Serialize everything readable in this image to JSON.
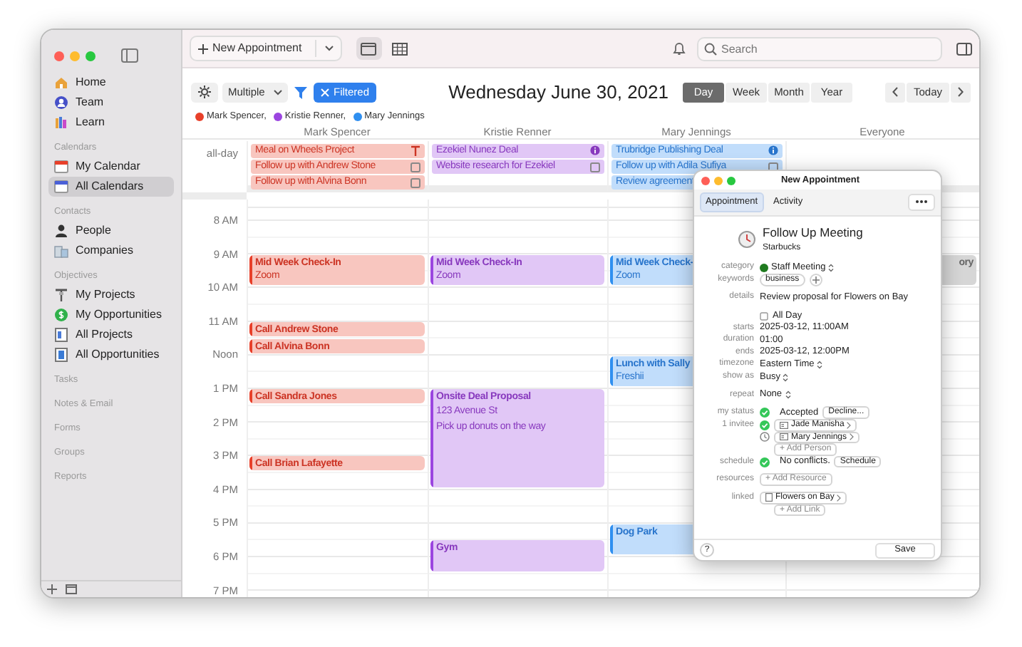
{
  "sidebar": {
    "sections": [
      {
        "items": [
          {
            "label": "Home",
            "kind": "home",
            "selected": false
          },
          {
            "label": "Team",
            "kind": "team",
            "selected": false
          },
          {
            "label": "Learn",
            "kind": "learn",
            "selected": false
          }
        ]
      },
      {
        "heading": "Calendars",
        "items": [
          {
            "label": "My Calendar",
            "kind": "calendar",
            "selected": false
          },
          {
            "label": "All Calendars",
            "kind": "calendars",
            "selected": true
          }
        ]
      },
      {
        "heading": "Contacts",
        "items": [
          {
            "label": "People",
            "kind": "person",
            "selected": false
          },
          {
            "label": "Companies",
            "kind": "companies",
            "selected": false
          }
        ]
      },
      {
        "heading": "Objectives",
        "items": [
          {
            "label": "My Projects",
            "kind": "projects",
            "selected": false
          },
          {
            "label": "My Opportunities",
            "kind": "opportunity",
            "selected": false
          },
          {
            "label": "All Projects",
            "kind": "project-list",
            "selected": false
          },
          {
            "label": "All Opportunities",
            "kind": "opportunity-list",
            "selected": false
          }
        ]
      },
      {
        "heading": "Tasks"
      },
      {
        "heading": "Notes & Email"
      },
      {
        "heading": "Forms"
      },
      {
        "heading": "Groups"
      },
      {
        "heading": "Reports"
      }
    ]
  },
  "toolbar": {
    "new_button": "New Appointment",
    "views": [
      {
        "kind": "day",
        "selected": true
      },
      {
        "kind": "grid",
        "selected": false
      }
    ],
    "search": {
      "placeholder": "Search"
    }
  },
  "filter_bar": {
    "mode": "Multiple",
    "filter": "Filtered",
    "date": "Wednesday June 30, 2021",
    "ranges": [
      {
        "label": "Day",
        "selected": true
      },
      {
        "label": "Week",
        "selected": false
      },
      {
        "label": "Month",
        "selected": false
      },
      {
        "label": "Year",
        "selected": false
      }
    ],
    "today": "Today",
    "people": [
      {
        "name": "Mark Spencer,",
        "color": "#e8402a"
      },
      {
        "name": "Kristie Renner,",
        "color": "#9b45e0"
      },
      {
        "name": "Mary Jennings",
        "color": "#2f8ff0"
      }
    ]
  },
  "calendar": {
    "all_day_label": "all-day",
    "hour_labels": [
      "8 AM",
      "9 AM",
      "10 AM",
      "11 AM",
      "Noon",
      "1 PM",
      "2 PM",
      "3 PM",
      "4 PM",
      "5 PM",
      "6 PM",
      "7 PM"
    ],
    "columns": [
      {
        "name": "Mark Spencer",
        "color": "#e8402a",
        "all_day": [
          {
            "title": "Meal on Wheels Project",
            "kind": "project"
          },
          {
            "title": "Follow up with Andrew Stone",
            "kind": "task",
            "checked": false
          },
          {
            "title": "Follow up with Alvina Bonn",
            "kind": "task",
            "checked": false
          }
        ],
        "events": [
          {
            "lines": [
              "Mid Week Check-In",
              "Zoom"
            ]
          },
          {
            "lines": [
              "Call Andrew Stone"
            ]
          },
          {
            "lines": [
              "Call Alvina Bonn"
            ]
          },
          {
            "lines": [
              "Call Sandra Jones"
            ]
          },
          {
            "lines": [
              "Call Brian Lafayette"
            ]
          }
        ]
      },
      {
        "name": "Kristie Renner",
        "color": "#9b45e0",
        "all_day": [
          {
            "title": "Ezekiel Nunez Deal",
            "kind": "deal"
          },
          {
            "title": "Website research for Ezekiel",
            "kind": "task",
            "checked": false
          }
        ],
        "events": [
          {
            "lines": [
              "Mid Week Check-In",
              "Zoom"
            ]
          },
          {
            "lines": [
              "Onsite Deal Proposal",
              "123 Avenue St",
              "Pick up donuts on the way"
            ]
          },
          {
            "lines": [
              "Gym"
            ]
          }
        ]
      },
      {
        "name": "Mary Jennings",
        "color": "#2f8ff0",
        "all_day": [
          {
            "title": "Trubridge Publishing Deal",
            "kind": "deal"
          },
          {
            "title": "Follow up with Adila Sufiya",
            "kind": "task",
            "checked": false
          },
          {
            "title": "Review agreement",
            "kind": "item"
          }
        ],
        "events": [
          {
            "lines": [
              "Mid Week Check-",
              "Zoom"
            ]
          },
          {
            "lines": [
              "Lunch with Sally",
              "Freshii"
            ]
          },
          {
            "lines": [
              "Dog Park"
            ]
          }
        ]
      },
      {
        "name": "Everyone",
        "color": "#d6d6d6",
        "kind": "shared",
        "events": [
          {
            "lines": [
              "ory"
            ]
          }
        ]
      }
    ]
  },
  "popup": {
    "title": "New Appointment",
    "tabs": [
      {
        "label": "Appointment",
        "selected": true
      },
      {
        "label": "Activity",
        "selected": false
      }
    ],
    "subject": "Follow Up Meeting",
    "location": "Starbucks",
    "groups": [
      [
        {
          "kind": "select",
          "label": "category",
          "value": "Staff Meeting"
        },
        {
          "kind": "tags",
          "label": "keywords",
          "tags": [
            "business"
          ]
        }
      ],
      [
        {
          "kind": "text",
          "label": "details",
          "value": "Review proposal for Flowers on Bay"
        }
      ],
      [
        {
          "kind": "checkbox",
          "value": "All Day",
          "checked": false
        },
        {
          "kind": "text",
          "label": "starts",
          "value": "2025-03-12, 11:00AM"
        },
        {
          "kind": "text",
          "label": "duration",
          "value": "01:00"
        },
        {
          "kind": "text",
          "label": "ends",
          "value": "2025-03-12, 12:00PM"
        },
        {
          "kind": "dropdown",
          "label": "timezone",
          "value": "Eastern Time"
        },
        {
          "kind": "dropdown",
          "label": "show as",
          "value": "Busy"
        }
      ],
      [
        {
          "kind": "dropdown",
          "label": "repeat",
          "value": "None"
        }
      ],
      [
        {
          "kind": "status",
          "label": "my status",
          "value": "Accepted",
          "button": "Decline...",
          "accepted": true
        },
        {
          "kind": "person",
          "label": "1 invitee",
          "value": "Jade Manisha",
          "accepted": true
        },
        {
          "kind": "person",
          "value": "Mary Jennings",
          "accepted": false
        },
        {
          "kind": "add",
          "value": "+ Add Person"
        },
        {
          "kind": "status",
          "label": "schedule",
          "value": "No conflicts.",
          "button": "Schedule",
          "accepted": true
        }
      ],
      [
        {
          "kind": "add",
          "label": "resources",
          "value": "+ Add Resource"
        }
      ],
      [
        {
          "kind": "linked",
          "label": "linked",
          "value": "Flowers on Bay"
        },
        {
          "kind": "add",
          "value": "+ Add Link"
        }
      ]
    ],
    "help": "?",
    "save": "Save"
  }
}
